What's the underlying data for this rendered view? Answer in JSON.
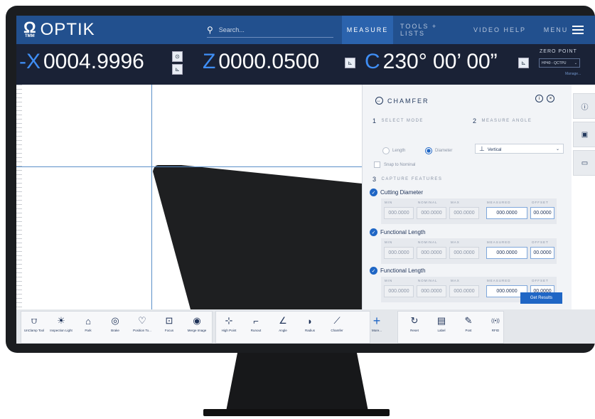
{
  "nav": {
    "logo_text": "OPTIK",
    "omega": "Ω",
    "omega_sub": "TMM",
    "search_placeholder": "Search...",
    "tabs": [
      {
        "label": "MEASURE",
        "active": true
      },
      {
        "label": "TOOLS + LISTS",
        "active": false
      },
      {
        "label": "VIDEO HELP",
        "active": false
      },
      {
        "label": "MENU",
        "active": false
      }
    ]
  },
  "dro": {
    "x": {
      "letter": "-X",
      "value": "0004.9996"
    },
    "z": {
      "letter": "Z",
      "value": "0000.0500"
    },
    "c": {
      "letter": "C",
      "value": "230° 00’ 00”"
    },
    "zero_point_label": "ZERO POINT",
    "zero_point_value": "HP40 - QCTPU",
    "manage": "Manage..."
  },
  "panel": {
    "title": "CHAMFER",
    "step1": {
      "num": "1",
      "label": "SELECT MODE"
    },
    "step2": {
      "num": "2",
      "label": "MEASURE ANGLE"
    },
    "step3": {
      "num": "3",
      "label": "CAPTURE FEATURES"
    },
    "mode_options": [
      {
        "label": "Length",
        "selected": false
      },
      {
        "label": "Diameter",
        "selected": true
      }
    ],
    "snap_label": "Snap to Nominal",
    "angle_value": "Vertical",
    "field_labels": {
      "min": "MIN",
      "nominal": "NOMINAL",
      "max": "MAX",
      "measured": "MEASURED",
      "offset": "OFFSET"
    },
    "features": [
      {
        "name": "Cutting Diameter",
        "min": "000.0000",
        "nominal": "000.0000",
        "max": "000.0000",
        "measured": "000.0000",
        "offset": "00.0000"
      },
      {
        "name": "Functional Length",
        "min": "000.0000",
        "nominal": "000.0000",
        "max": "000.0000",
        "measured": "000.0000",
        "offset": "00.0000"
      },
      {
        "name": "Functional Length",
        "min": "000.0000",
        "nominal": "000.0000",
        "max": "000.0000",
        "measured": "000.0000",
        "offset": "00.0000"
      }
    ],
    "get_results": "Get Results"
  },
  "toolbar": {
    "tools": [
      {
        "label": "UnClamp Tool",
        "icon": "unclamp-icon",
        "glyph": "⩌"
      },
      {
        "label": "Inspection Light",
        "icon": "light-icon",
        "glyph": "☀"
      },
      {
        "label": "Park",
        "icon": "park-icon",
        "glyph": "⌂"
      },
      {
        "label": "Brake",
        "icon": "brake-icon",
        "glyph": "◎"
      },
      {
        "label": "Position To...",
        "icon": "position-icon",
        "glyph": "♡"
      },
      {
        "label": "Focus",
        "icon": "focus-icon",
        "glyph": "⊡"
      },
      {
        "label": "Merge Image",
        "icon": "merge-icon",
        "glyph": "◉"
      },
      {
        "label": "High Point",
        "icon": "high-point-icon",
        "glyph": "⊹"
      },
      {
        "label": "Runout",
        "icon": "runout-icon",
        "glyph": "⌐"
      },
      {
        "label": "Angle",
        "icon": "angle-icon",
        "glyph": "∠"
      },
      {
        "label": "Radius",
        "icon": "radius-icon",
        "glyph": "◗"
      },
      {
        "label": "Chamfer",
        "icon": "chamfer-icon",
        "glyph": "⟋"
      },
      {
        "label": "More...",
        "icon": "plus-icon",
        "glyph": "+"
      },
      {
        "label": "Reset",
        "icon": "reset-icon",
        "glyph": "↻"
      },
      {
        "label": "Label",
        "icon": "label-icon",
        "glyph": "▤"
      },
      {
        "label": "Post",
        "icon": "post-icon",
        "glyph": "✎"
      },
      {
        "label": "RFID",
        "icon": "rfid-icon",
        "glyph": "((•))"
      }
    ]
  },
  "colors": {
    "nav": "#22508e",
    "dro": "#1a2236",
    "accent": "#1f66c5",
    "axis_letter": "#3f8ef5"
  }
}
